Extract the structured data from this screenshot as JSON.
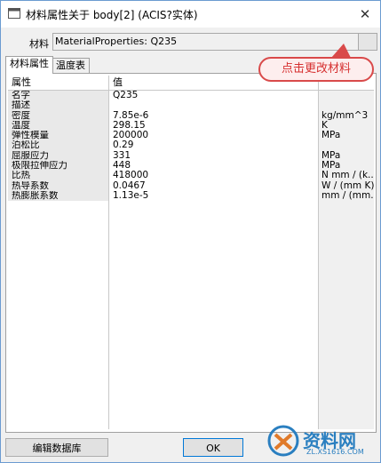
{
  "window": {
    "title": "材料属性关于 body[2] (ACIS?实体)",
    "close_glyph": "✕"
  },
  "material": {
    "label": "材料",
    "value": "MaterialProperties: Q235"
  },
  "tabs": [
    {
      "label": "材料属性",
      "active": true
    },
    {
      "label": "温度表",
      "active": false
    }
  ],
  "callout": {
    "text": "点击更改材料",
    "color": "#d63030"
  },
  "table": {
    "headers": [
      "属性",
      "值",
      ""
    ],
    "rows": [
      {
        "name": "名字",
        "value": "Q235",
        "unit": ""
      },
      {
        "name": "描述",
        "value": "",
        "unit": ""
      },
      {
        "name": "密度",
        "value": "7.85e-6",
        "unit": "kg/mm^3"
      },
      {
        "name": "温度",
        "value": "298.15",
        "unit": "K"
      },
      {
        "name": "弹性模量",
        "value": "200000",
        "unit": "MPa"
      },
      {
        "name": "泊松比",
        "value": "0.29",
        "unit": ""
      },
      {
        "name": "屈服应力",
        "value": "331",
        "unit": "MPa"
      },
      {
        "name": "极限拉伸应力",
        "value": "448",
        "unit": "MPa"
      },
      {
        "name": "比热",
        "value": "418000",
        "unit": "N mm / (k..."
      },
      {
        "name": "热导系数",
        "value": "0.0467",
        "unit": "W / (mm K)"
      },
      {
        "name": "热膨胀系数",
        "value": "1.13e-5",
        "unit": "mm / (mm..."
      }
    ]
  },
  "buttons": {
    "edit_database": "编辑数据库",
    "ok": "OK"
  },
  "watermark": {
    "name": "资料网",
    "url": "ZL.XS1616.COM"
  },
  "colors": {
    "accent": "#0078d7",
    "callout_border": "#d94a4a",
    "watermark": "#2a7fc0"
  }
}
